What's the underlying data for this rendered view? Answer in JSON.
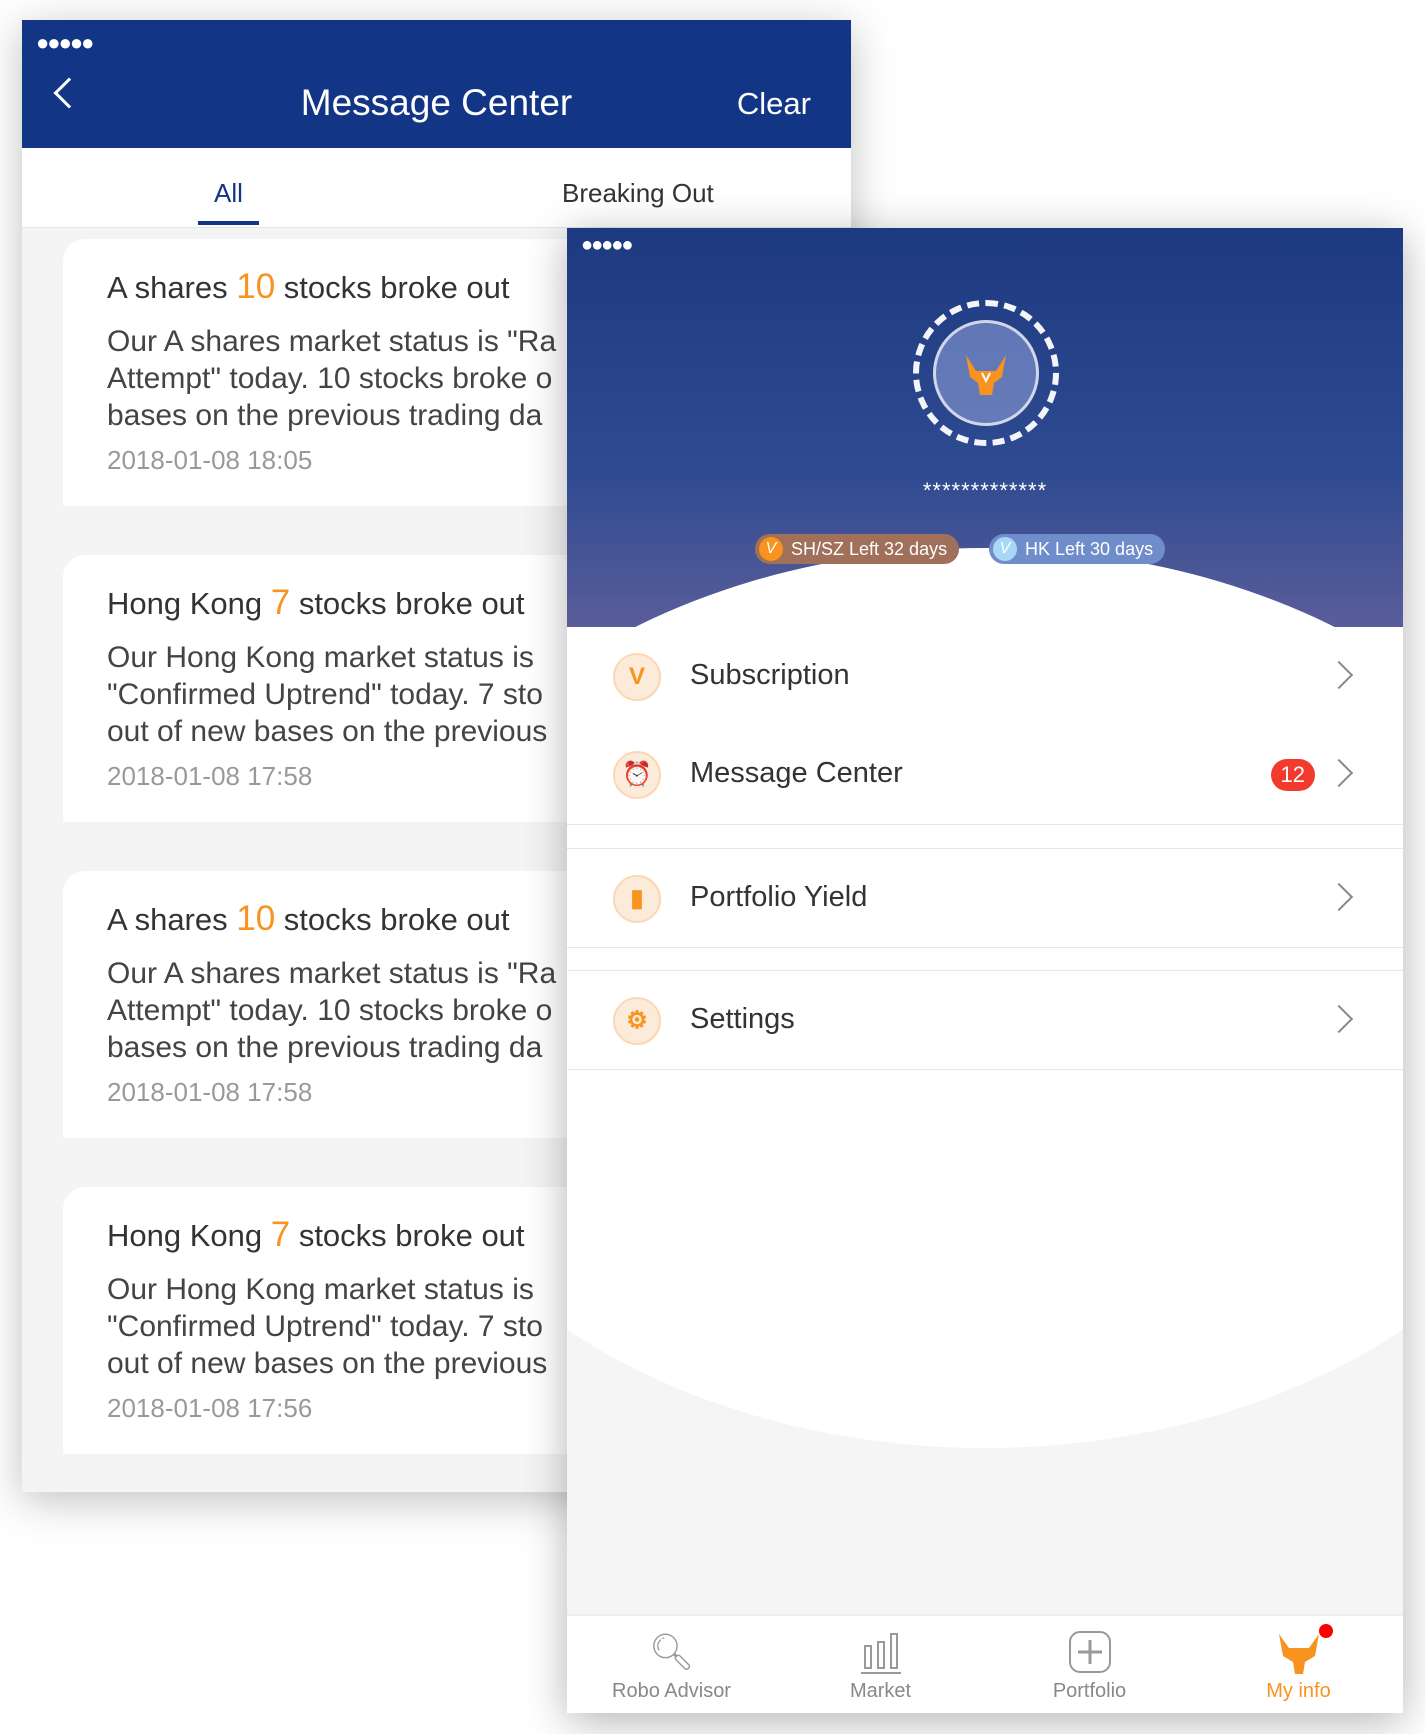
{
  "message_center": {
    "status": "●●●●● ",
    "title": "Message Center",
    "clear_label": "Clear",
    "tabs": [
      {
        "label": "All",
        "active": true
      },
      {
        "label": "Breaking Out",
        "active": false
      }
    ],
    "messages": [
      {
        "title_pre": "A shares ",
        "count": "10",
        "title_post": " stocks broke out",
        "lines": [
          "Our A shares market status is \"Ra",
          "Attempt\" today. 10 stocks broke o",
          "bases on the previous trading da"
        ],
        "date": "2018-01-08 18:05"
      },
      {
        "title_pre": "Hong Kong ",
        "count": "7",
        "title_post": " stocks broke out",
        "lines": [
          "Our Hong Kong market status is",
          "\"Confirmed Uptrend\" today. 7 sto",
          "out of new bases on the previous"
        ],
        "date": "2018-01-08 17:58"
      },
      {
        "title_pre": "A shares ",
        "count": "10",
        "title_post": " stocks broke out",
        "lines": [
          "Our A shares market status is \"Ra",
          "Attempt\" today. 10 stocks broke o",
          "bases on the previous trading da"
        ],
        "date": "2018-01-08 17:58"
      },
      {
        "title_pre": "Hong Kong ",
        "count": "7",
        "title_post": " stocks broke out",
        "lines": [
          "Our Hong Kong market status is",
          "\"Confirmed Uptrend\" today. 7 sto",
          "out of new bases on the previous"
        ],
        "date": "2018-01-08 17:56"
      }
    ]
  },
  "my_info": {
    "status": "●●●●● ",
    "username": "*************",
    "pills": [
      {
        "icon": "V",
        "label": "SH/SZ Left 32 days"
      },
      {
        "icon": "V",
        "label": "HK Left 30 days"
      }
    ],
    "menu": [
      {
        "label": "Subscription",
        "icon": "v-badge-icon"
      },
      {
        "label": "Message Center",
        "icon": "alarm-clock-icon",
        "badge": "12"
      },
      {
        "label": "Portfolio Yield",
        "icon": "wallet-icon"
      },
      {
        "label": "Settings",
        "icon": "gear-icon"
      }
    ],
    "tabbar": [
      {
        "label": "Robo Advisor",
        "icon": "magnifier-chart-icon"
      },
      {
        "label": "Market",
        "icon": "bar-chart-icon"
      },
      {
        "label": "Portfolio",
        "icon": "plus-square-icon"
      },
      {
        "label": "My info",
        "icon": "bull-icon",
        "active": true
      }
    ],
    "accent": "#f7931e",
    "header": "#133585",
    "badge_color": "#f23b2c"
  }
}
